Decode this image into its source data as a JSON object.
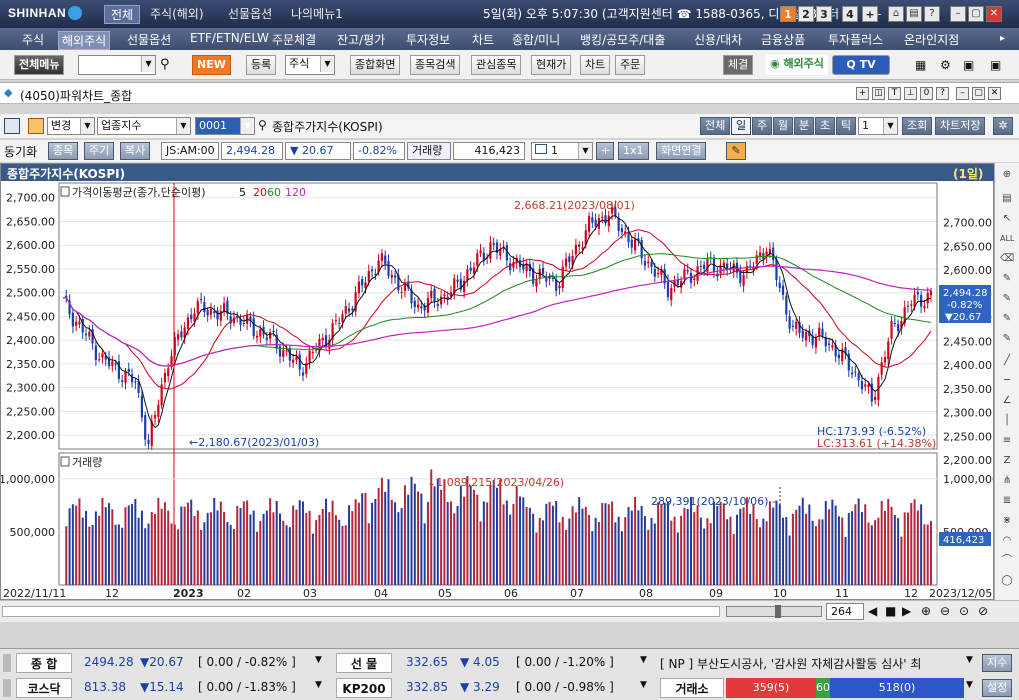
{
  "titlebar": {
    "brand": "SHINHAN",
    "tabs": [
      "전체",
      "주식(해외)",
      "선물옵션",
      "나의메뉴1"
    ],
    "info": "5일(화) 오후 5:07:30 (고객지원센터 ☎ 1588-0365, 디지털PB센터 ☎ 02-",
    "numbers": [
      "1",
      "2",
      "3",
      "4",
      "+"
    ]
  },
  "menubar": {
    "items": [
      "주식",
      "해외주식",
      "선물옵션",
      "ETF/ETN/ELW",
      "주문체결",
      "잔고/평가",
      "투자정보",
      "차트",
      "종합/미니",
      "뱅킹/공모주/대출",
      "신용/대차",
      "금융상품",
      "투자플러스",
      "온라인지점"
    ],
    "active": "해외주식"
  },
  "toolbar": {
    "menu_btn": "전체메뉴",
    "new_badge": "NEW",
    "reg": "등록",
    "stock_sel": "주식",
    "buttons": [
      "종합화면",
      "종목검색",
      "관심종목",
      "현재가",
      "차트",
      "주문"
    ],
    "fill": "체결",
    "overseas": "해외주식",
    "qtv": "TV"
  },
  "doc": {
    "title": "(4050)파워차트_종합"
  },
  "controls": {
    "change_label": "변경",
    "category": "업종지수",
    "code": "0001",
    "name": "종합주가지수(KOSPI)",
    "periods": [
      "전체",
      "일",
      "주",
      "월",
      "분",
      "초",
      "틱"
    ],
    "active_period": "일",
    "count": "1",
    "lookup": "조회",
    "save": "차트저장",
    "sync": "동기화",
    "tab_item": "종목",
    "tab_period": "주기",
    "tab_copy": "복사",
    "time": "JS:AM:00",
    "price": "2,494.28",
    "change": "▼ 20.67",
    "change_pct": "-0.82%",
    "vol_label": "거래량",
    "volume": "416,423",
    "n_val": "1",
    "ratio": "1x1",
    "link": "화면연결"
  },
  "chart": {
    "header": "종합주가지수(KOSPI)",
    "period_badge": "(1일)",
    "ma_label": "가격이동평균(종가,단순이평)",
    "ma_periods": [
      "5",
      "20",
      "60",
      "120"
    ],
    "ma_colors": {
      "5": "#111111",
      "20": "#d0021b",
      "60": "#1a8a1a",
      "120": "#c021c0"
    },
    "up_color": "#d0021b",
    "down_color": "#1a3fa8",
    "price_ticks": [
      "2,700.00",
      "2,650.00",
      "2,600.00",
      "2,550.00",
      "2,500.00",
      "2,450.00",
      "2,400.00",
      "2,350.00",
      "2,300.00",
      "2,250.00",
      "2,200.00"
    ],
    "high_note": "2,668.21(2023/08/01)",
    "low_note": "2,180.67(2023/01/03)",
    "hc": "HC:173.93 (-6.52%)",
    "lc": "LC:313.61 (+14.38%)",
    "last_price": "2,494.28",
    "last_chg": "-0.82%",
    "last_diff": "▼20.67",
    "vol_title": "거래량",
    "vol_ticks": [
      "1,000,000",
      "500,000"
    ],
    "vol_high_note": "1,089,215(2023/04/26)",
    "vol_mark_note": "289,391(2023/10/06)",
    "last_vol": "416,423",
    "x_labels": [
      "2022/11/11",
      "12",
      "2023",
      "02",
      "03",
      "04",
      "05",
      "06",
      "07",
      "08",
      "09",
      "10",
      "11",
      "12",
      "2023/12/05"
    ],
    "scroll_count": "264"
  },
  "bottom": {
    "r1": {
      "name": "종 합",
      "val": "2494.28",
      "chg": "▼20.67",
      "detail": "[ 0.00 / -0.82% ]",
      "name2": "선 물",
      "val2": "332.65",
      "chg2": "▼ 4.05",
      "detail2": "[ 0.00 / -1.20% ]",
      "news": "[ NP ] 부산도시공사, '감사원 자체감사활동 심사' 최",
      "btn": "지수"
    },
    "r2": {
      "name": "코스닥",
      "val": "813.38",
      "chg": "▼15.14",
      "detail": "[ 0.00 / -1.83% ]",
      "name2": "KP200",
      "val2": "332.85",
      "chg2": "▼ 3.29",
      "detail2": "[ 0.00 / -0.98% ]",
      "name3": "거래소",
      "up": "359(5)",
      "flat": "60",
      "down": "518(0)",
      "btn": "설정"
    }
  }
}
